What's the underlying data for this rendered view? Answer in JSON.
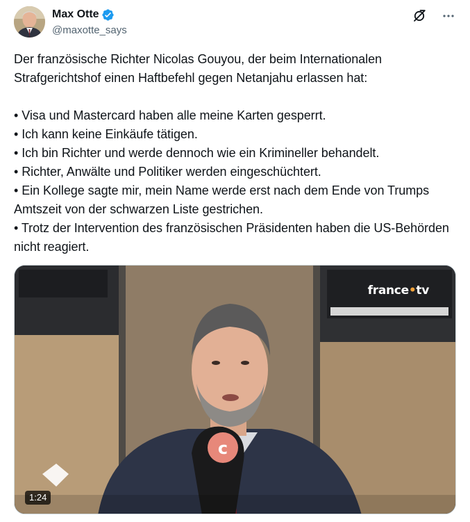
{
  "author": {
    "display_name": "Max Otte",
    "handle": "@maxotte_says",
    "verified": true,
    "verified_color": "#1d9bf0"
  },
  "actions": {
    "grok_icon": "grok-icon",
    "more_icon": "more-icon"
  },
  "tweet": {
    "intro": "Der französische Richter Nicolas Gouyou, der beim Internationalen Strafgerichtshof einen Haftbefehl gegen Netanjahu erlassen hat:",
    "bullets": [
      "• Visa und Mastercard haben alle meine Karten gesperrt.",
      "• Ich kann keine Einkäufe tätigen.",
      "• Ich bin Richter und werde dennoch wie ein Krimineller behandelt.",
      "• Richter, Anwälte und Politiker werden eingeschüchtert.",
      "• Ein Kollege sagte mir, mein Name werde erst nach dem Ende von Trumps Amtszeit von der schwarzen Liste gestrichen.",
      "• Trotz der Intervention des französischen Präsidenten haben die US-Behörden nicht reagiert."
    ]
  },
  "media": {
    "watermark_left": "france",
    "watermark_dot": "•",
    "watermark_right": "tv",
    "duration": "1:24",
    "type": "video"
  },
  "colors": {
    "text": "#0f1419",
    "secondary": "#536471",
    "border": "#cfd9de",
    "accent": "#1d9bf0"
  }
}
